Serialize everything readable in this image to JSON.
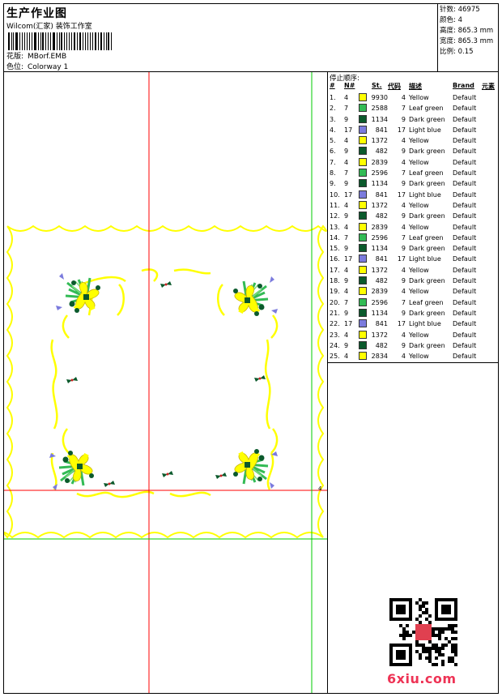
{
  "header": {
    "title": "生产作业图",
    "subtitle": "Wilcom(汇家) 装饰工作室",
    "design_label": "花版:",
    "design_value": "MBorf.EMB",
    "colorway_label": "色位:",
    "colorway_value": "Colorway 1"
  },
  "stats": [
    {
      "label": "针数",
      "value": "46975"
    },
    {
      "label": "颜色",
      "value": "4"
    },
    {
      "label": "高度",
      "value": "865.3 mm"
    },
    {
      "label": "宽度",
      "value": "865.3 mm"
    },
    {
      "label": "比例",
      "value": "0.15"
    }
  ],
  "stop_sequence": {
    "caption": "停止顺序:",
    "columns": {
      "idx": "#",
      "no": "N#",
      "st": "St.",
      "code": "代码",
      "desc": "描述",
      "brand": "Brand",
      "elem": "元素"
    },
    "rows": [
      {
        "idx": "1.",
        "no": "4",
        "color": "#ffff00",
        "st": "9930",
        "code": "4",
        "desc": "Yellow",
        "brand": "Default"
      },
      {
        "idx": "2.",
        "no": "7",
        "color": "#33bb55",
        "st": "2588",
        "code": "7",
        "desc": "Leaf green",
        "brand": "Default"
      },
      {
        "idx": "3.",
        "no": "9",
        "color": "#0b5a2c",
        "st": "1134",
        "code": "9",
        "desc": "Dark green",
        "brand": "Default"
      },
      {
        "idx": "4.",
        "no": "17",
        "color": "#7b7bdd",
        "st": "841",
        "code": "17",
        "desc": "Light blue",
        "brand": "Default"
      },
      {
        "idx": "5.",
        "no": "4",
        "color": "#ffff00",
        "st": "1372",
        "code": "4",
        "desc": "Yellow",
        "brand": "Default"
      },
      {
        "idx": "6.",
        "no": "9",
        "color": "#0b5a2c",
        "st": "482",
        "code": "9",
        "desc": "Dark green",
        "brand": "Default"
      },
      {
        "idx": "7.",
        "no": "4",
        "color": "#ffff00",
        "st": "2839",
        "code": "4",
        "desc": "Yellow",
        "brand": "Default"
      },
      {
        "idx": "8.",
        "no": "7",
        "color": "#33bb55",
        "st": "2596",
        "code": "7",
        "desc": "Leaf green",
        "brand": "Default"
      },
      {
        "idx": "9.",
        "no": "9",
        "color": "#0b5a2c",
        "st": "1134",
        "code": "9",
        "desc": "Dark green",
        "brand": "Default"
      },
      {
        "idx": "10.",
        "no": "17",
        "color": "#7b7bdd",
        "st": "841",
        "code": "17",
        "desc": "Light blue",
        "brand": "Default"
      },
      {
        "idx": "11.",
        "no": "4",
        "color": "#ffff00",
        "st": "1372",
        "code": "4",
        "desc": "Yellow",
        "brand": "Default"
      },
      {
        "idx": "12.",
        "no": "9",
        "color": "#0b5a2c",
        "st": "482",
        "code": "9",
        "desc": "Dark green",
        "brand": "Default"
      },
      {
        "idx": "13.",
        "no": "4",
        "color": "#ffff00",
        "st": "2839",
        "code": "4",
        "desc": "Yellow",
        "brand": "Default"
      },
      {
        "idx": "14.",
        "no": "7",
        "color": "#33bb55",
        "st": "2596",
        "code": "7",
        "desc": "Leaf green",
        "brand": "Default"
      },
      {
        "idx": "15.",
        "no": "9",
        "color": "#0b5a2c",
        "st": "1134",
        "code": "9",
        "desc": "Dark green",
        "brand": "Default"
      },
      {
        "idx": "16.",
        "no": "17",
        "color": "#7b7bdd",
        "st": "841",
        "code": "17",
        "desc": "Light blue",
        "brand": "Default"
      },
      {
        "idx": "17.",
        "no": "4",
        "color": "#ffff00",
        "st": "1372",
        "code": "4",
        "desc": "Yellow",
        "brand": "Default"
      },
      {
        "idx": "18.",
        "no": "9",
        "color": "#0b5a2c",
        "st": "482",
        "code": "9",
        "desc": "Dark green",
        "brand": "Default"
      },
      {
        "idx": "19.",
        "no": "4",
        "color": "#ffff00",
        "st": "2839",
        "code": "4",
        "desc": "Yellow",
        "brand": "Default"
      },
      {
        "idx": "20.",
        "no": "7",
        "color": "#33bb55",
        "st": "2596",
        "code": "7",
        "desc": "Leaf green",
        "brand": "Default"
      },
      {
        "idx": "21.",
        "no": "9",
        "color": "#0b5a2c",
        "st": "1134",
        "code": "9",
        "desc": "Dark green",
        "brand": "Default"
      },
      {
        "idx": "22.",
        "no": "17",
        "color": "#7b7bdd",
        "st": "841",
        "code": "17",
        "desc": "Light blue",
        "brand": "Default"
      },
      {
        "idx": "23.",
        "no": "4",
        "color": "#ffff00",
        "st": "1372",
        "code": "4",
        "desc": "Yellow",
        "brand": "Default"
      },
      {
        "idx": "24.",
        "no": "9",
        "color": "#0b5a2c",
        "st": "482",
        "code": "9",
        "desc": "Dark green",
        "brand": "Default"
      },
      {
        "idx": "25.",
        "no": "4",
        "color": "#ffff00",
        "st": "2834",
        "code": "4",
        "desc": "Yellow",
        "brand": "Default"
      }
    ]
  },
  "colors": {
    "yellow": "#ffff00",
    "leaf_green": "#33bb55",
    "dark_green": "#0b5a2c",
    "light_blue": "#7b7bdd",
    "guide_red": "#ff0000",
    "guide_green": "#00cc00"
  },
  "preview": {
    "scale_marker": "4"
  },
  "watermark": {
    "logo_text": "6xiu.com",
    "qr_icon": "qr-code-icon"
  }
}
